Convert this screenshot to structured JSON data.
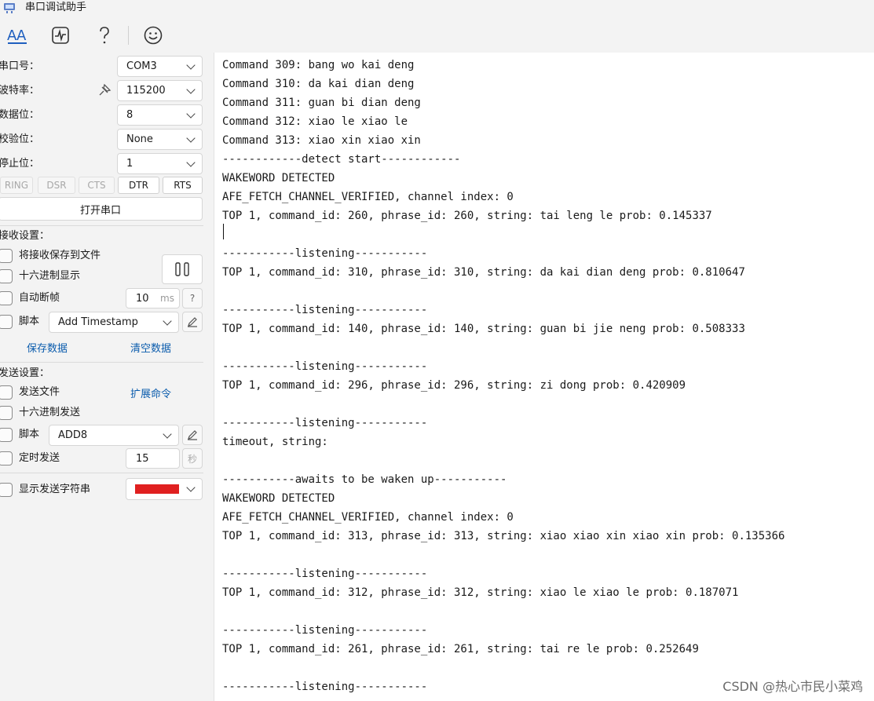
{
  "window": {
    "title": "串口调试助手"
  },
  "serial": {
    "port_label": "串口号：",
    "port_value": "COM3",
    "baud_label": "波特率：",
    "baud_value": "115200",
    "databits_label": "数据位：",
    "databits_value": "8",
    "parity_label": "校验位：",
    "parity_value": "None",
    "stopbits_label": "停止位：",
    "stopbits_value": "1",
    "signals": [
      "RING",
      "DSR",
      "CTS",
      "DTR",
      "RTS"
    ],
    "open_button": "打开串口"
  },
  "receive": {
    "section_label": "接收设置：",
    "save_to_file": "将接收保存到文件",
    "hex_display": "十六进制显示",
    "auto_frame": "自动断帧",
    "frame_value": "10",
    "frame_unit": "ms",
    "help": "?",
    "script_label": "脚本",
    "script_value": "Add Timestamp",
    "save_data": "保存数据",
    "clear_data": "清空数据"
  },
  "send": {
    "section_label": "发送设置：",
    "send_file": "发送文件",
    "extend_cmd": "扩展命令",
    "hex_send": "十六进制发送",
    "script_label": "脚本",
    "script_value": "ADD8",
    "timed_send": "定时发送",
    "timed_value": "15",
    "timed_unit": "秒",
    "show_send_string": "显示发送字符串",
    "color": "#e02020"
  },
  "output": {
    "lines": [
      "Command 309: bang wo kai deng",
      "Command 310: da kai dian deng",
      "Command 311: guan bi dian deng",
      "Command 312: xiao le xiao le",
      "Command 313: xiao xin xiao xin",
      "------------detect start------------",
      "WAKEWORD DETECTED",
      "AFE_FETCH_CHANNEL_VERIFIED, channel index: 0",
      "TOP 1, command_id: 260, phrase_id: 260, string: tai leng le prob: 0.145337",
      "",
      "-----------listening-----------",
      "TOP 1, command_id: 310, phrase_id: 310, string: da kai dian deng prob: 0.810647",
      "",
      "-----------listening-----------",
      "TOP 1, command_id: 140, phrase_id: 140, string: guan bi jie neng prob: 0.508333",
      "",
      "-----------listening-----------",
      "TOP 1, command_id: 296, phrase_id: 296, string: zi dong prob: 0.420909",
      "",
      "-----------listening-----------",
      "timeout, string:",
      "",
      "-----------awaits to be waken up-----------",
      "WAKEWORD DETECTED",
      "AFE_FETCH_CHANNEL_VERIFIED, channel index: 0",
      "TOP 1, command_id: 313, phrase_id: 313, string: xiao xiao xin xiao xin prob: 0.135366",
      "",
      "-----------listening-----------",
      "TOP 1, command_id: 312, phrase_id: 312, string: xiao le xiao le prob: 0.187071",
      "",
      "-----------listening-----------",
      "TOP 1, command_id: 261, phrase_id: 261, string: tai re le prob: 0.252649",
      "",
      "-----------listening-----------"
    ],
    "watermark": "CSDN @热心市民小菜鸡"
  },
  "icons": {
    "toolbar": [
      "font-icon",
      "waveform-icon",
      "help-icon",
      "smiley-icon"
    ]
  }
}
